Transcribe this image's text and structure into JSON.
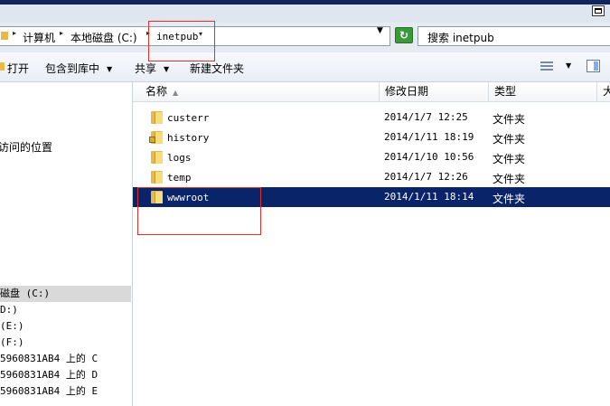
{
  "address_bar": {
    "crumbs": [
      "计算机",
      "本地磁盘 (C:)",
      "inetpub"
    ]
  },
  "search": {
    "text": "搜索 inetpub"
  },
  "toolbar": {
    "open_label": "打开",
    "include_label": "包含到库中",
    "share_label": "共享",
    "new_folder_label": "新建文件夹"
  },
  "nav": {
    "recent_places": "访问的位置",
    "items": [
      "磁盘 (C:)",
      "D:)",
      "(E:)",
      " (F:)",
      "5960831AB4 上的 C",
      "5960831AB4 上的 D",
      "5960831AB4 上的 E"
    ]
  },
  "columns": {
    "name": "名称",
    "date": "修改日期",
    "type": "类型",
    "size": "大"
  },
  "files": [
    {
      "name": "custerr",
      "date": "2014/1/7 12:25",
      "type": "文件夹",
      "icon": "folder-icon"
    },
    {
      "name": "history",
      "date": "2014/1/11 18:19",
      "type": "文件夹",
      "icon": "locked-folder-icon"
    },
    {
      "name": "logs",
      "date": "2014/1/10 10:56",
      "type": "文件夹",
      "icon": "folder-icon"
    },
    {
      "name": "temp",
      "date": "2014/1/7 12:26",
      "type": "文件夹",
      "icon": "folder-icon"
    },
    {
      "name": "wwwroot",
      "date": "2014/1/11 18:14",
      "type": "文件夹",
      "icon": "folder-icon",
      "selected": true
    }
  ],
  "colors": {
    "selection": "#0a246a",
    "annotation_red": "#e0302c",
    "title_bar": "#10255a"
  }
}
